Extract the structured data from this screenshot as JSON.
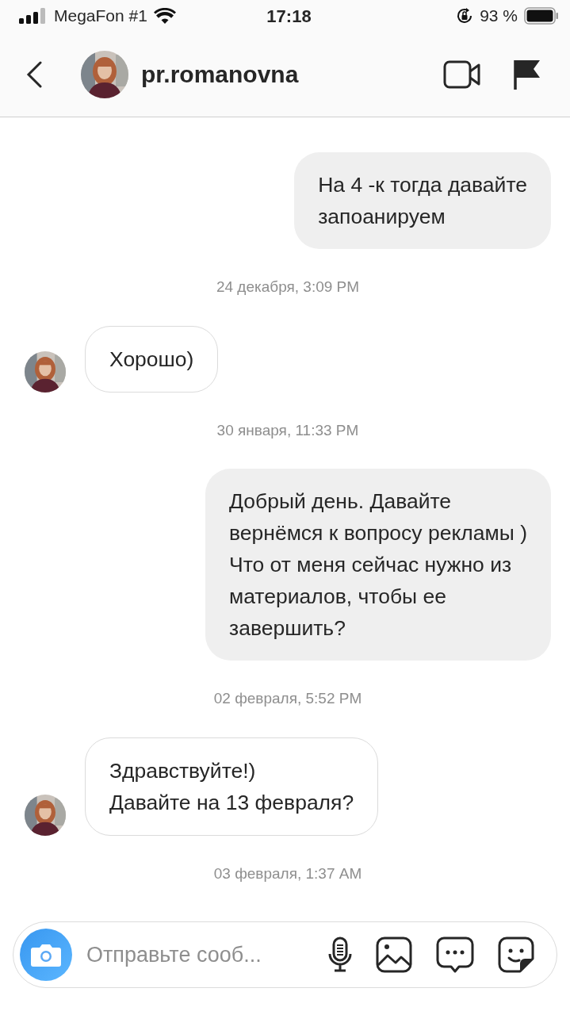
{
  "status_bar": {
    "carrier": "MegaFon #1",
    "time": "17:18",
    "battery": "93 %"
  },
  "header": {
    "username": "pr.romanovna"
  },
  "messages": [
    {
      "kind": "outgoing",
      "text": "На 4 -к тогда давайте\nзапоанируем"
    },
    {
      "kind": "date",
      "text": "24 декабря, 3:09 PM"
    },
    {
      "kind": "incoming",
      "text": "Хорошо)"
    },
    {
      "kind": "date",
      "text": "30 января, 11:33 PM"
    },
    {
      "kind": "outgoing",
      "text": "Добрый день. Давайте\nвернёмся к вопросу рекламы )\nЧто от меня сейчас нужно из\nматериалов, чтобы ее\nзавершить?"
    },
    {
      "kind": "date",
      "text": "02 февраля, 5:52 PM"
    },
    {
      "kind": "incoming",
      "text": "Здравствуйте!)\nДавайте на 13 февраля?"
    },
    {
      "kind": "date",
      "text": "03 февраля, 1:37 AM"
    }
  ],
  "composer": {
    "placeholder": "Отправьте сооб..."
  }
}
